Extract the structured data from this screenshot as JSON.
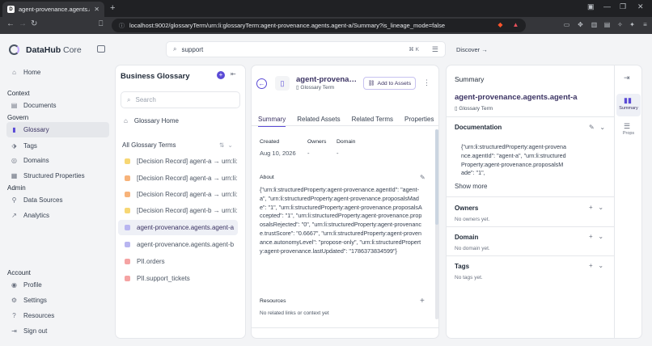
{
  "browser": {
    "tab_title": "agent-provenance.agents.agent",
    "tab_favicon": "D",
    "url": "localhost:9002/glossaryTerm/urn:li:glossaryTerm:agent-provenance.agents.agent-a/Summary?is_lineage_mode=false"
  },
  "app": {
    "brand": "DataHub",
    "edition": "Core",
    "search_value": "support",
    "search_shortcut": "⌘ K",
    "discover_label": "Discover"
  },
  "nav": {
    "home": "Home",
    "context_heading": "Context",
    "documents": "Documents",
    "govern_heading": "Govern",
    "glossary": "Glossary",
    "tags": "Tags",
    "domains": "Domains",
    "structured_properties": "Structured Properties",
    "admin_heading": "Admin",
    "data_sources": "Data Sources",
    "analytics": "Analytics",
    "account_heading": "Account",
    "profile": "Profile",
    "settings": "Settings",
    "resources": "Resources",
    "sign_out": "Sign out"
  },
  "glossary": {
    "title": "Business Glossary",
    "search_placeholder": "Search",
    "home_label": "Glossary Home",
    "all_terms_label": "All Glossary Terms",
    "items": [
      {
        "label": "[Decision Record] agent-a → urn:li:...",
        "color": "#f7d774"
      },
      {
        "label": "[Decision Record] agent-a → urn:li:...",
        "color": "#f7b37a"
      },
      {
        "label": "[Decision Record] agent-a → urn:li:...",
        "color": "#f7b37a"
      },
      {
        "label": "[Decision Record] agent-b → urn:li:...",
        "color": "#f7d774"
      },
      {
        "label": "agent-provenance.agents.agent-a",
        "color": "#b8b5f0"
      },
      {
        "label": "agent-provenance.agents.agent-b",
        "color": "#b8b5f0"
      },
      {
        "label": "PII.orders",
        "color": "#f5a3a3"
      },
      {
        "label": "PII.support_tickets",
        "color": "#f5a3a3"
      }
    ]
  },
  "entity": {
    "name": "agent-provenance.agents.agent-a",
    "type": "Glossary Term",
    "add_assets_label": "Add to Assets",
    "tabs": [
      "Summary",
      "Related Assets",
      "Related Terms",
      "Properties"
    ],
    "created_label": "Created",
    "created_value": "Aug 10, 2026",
    "owners_label": "Owners",
    "owners_value": "-",
    "domain_label": "Domain",
    "domain_value": "-",
    "about_label": "About",
    "about_text": "{\"urn:li:structuredProperty:agent-provenance.agentId\": \"agent-a\", \"urn:li:structuredProperty:agent-provenance.proposalsMade\": \"1\", \"urn:li:structuredProperty:agent-provenance.proposalsAccepted\": \"1\", \"urn:li:structuredProperty:agent-provenance.proposalsRejected\": \"0\", \"urn:li:structuredProperty:agent-provenance.trustScore\": \"0.6667\", \"urn:li:structuredProperty:agent-provenance.autonomyLevel\": \"propose-only\", \"urn:li:structuredProperty:agent-provenance.lastUpdated\": \"1786373834599\"}",
    "resources_label": "Resources",
    "resources_empty": "No related links or context yet"
  },
  "summary": {
    "title": "Summary",
    "name": "agent-provenance.agents.agent-a",
    "type": "Glossary Term",
    "documentation_label": "Documentation",
    "documentation_text": "{\"urn:li:structuredProperty:agent-provenance.agentId\": \"agent-a\", \"urn:li:structuredProperty:agent-provenance.proposalsMade\": \"1\",",
    "show_more": "Show more",
    "owners_label": "Owners",
    "owners_empty": "No owners yet.",
    "domain_label": "Domain",
    "domain_empty": "No domain yet.",
    "tags_label": "Tags",
    "tags_empty": "No tags yet.",
    "rail_summary": "Summary",
    "rail_props": "Props"
  },
  "colors": {
    "accent": "#5b4bd6",
    "brand_text": "#3b3363"
  }
}
